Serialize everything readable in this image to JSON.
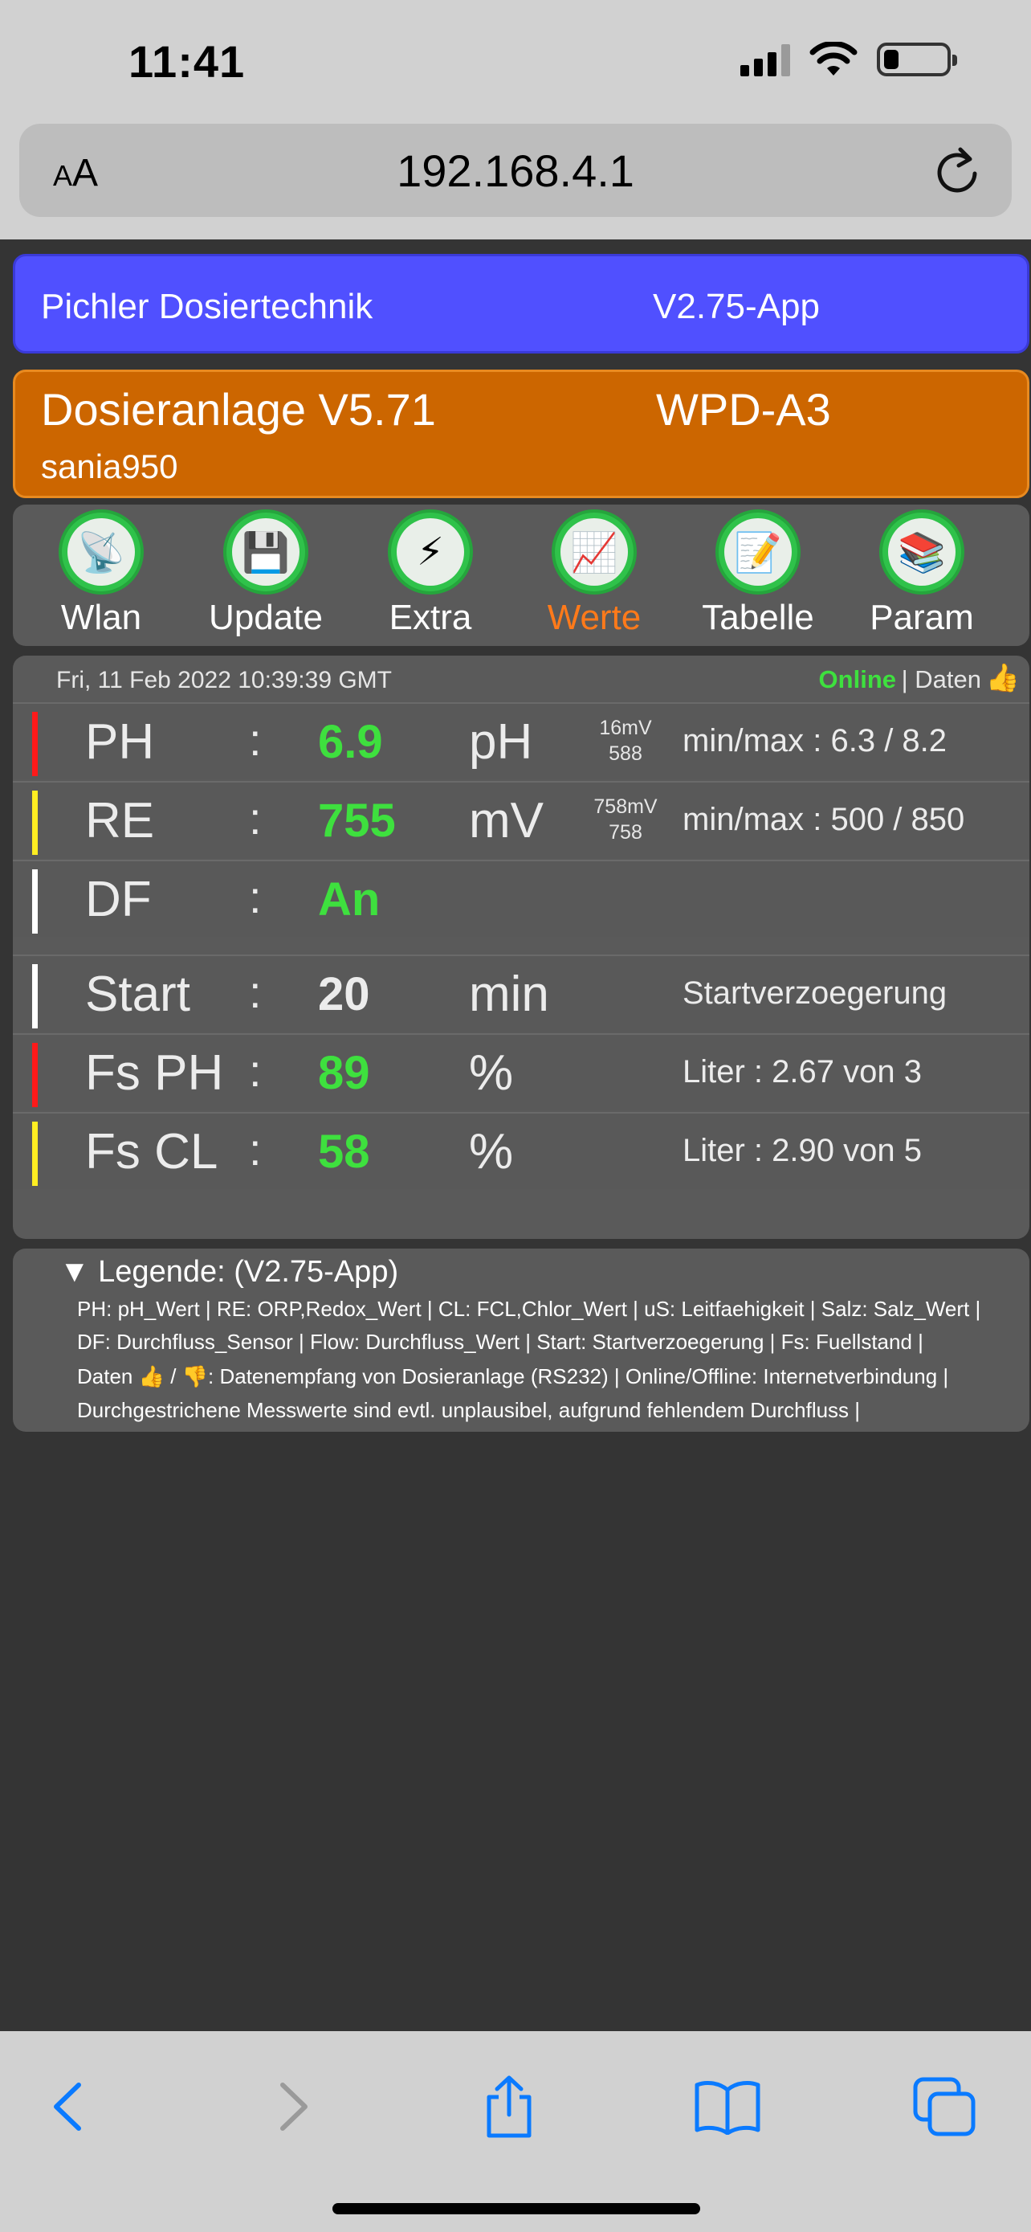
{
  "status": {
    "time": "11:41"
  },
  "browser": {
    "text_size_small": "A",
    "text_size_large": "A",
    "url": "192.168.4.1"
  },
  "header": {
    "company": "Pichler Dosiertechnik",
    "app_version": "V2.75-App"
  },
  "device": {
    "title": "Dosieranlage V5.71",
    "model": "WPD-A3",
    "user": "sania950"
  },
  "nav": [
    {
      "label": "Wlan",
      "icon": "satellite-dish-icon",
      "glyph": "📡",
      "active": false
    },
    {
      "label": "Update",
      "icon": "floppy-disk-icon",
      "glyph": "💾",
      "active": false
    },
    {
      "label": "Extra",
      "icon": "lightning-icon",
      "glyph": "⚡",
      "active": false
    },
    {
      "label": "Werte",
      "icon": "chart-icon",
      "glyph": "📈",
      "active": true
    },
    {
      "label": "Tabelle",
      "icon": "memo-icon",
      "glyph": "📝",
      "active": false
    },
    {
      "label": "Param",
      "icon": "books-icon",
      "glyph": "📚",
      "active": false
    }
  ],
  "info": {
    "datetime": "Fri, 11 Feb 2022 10:39:39 GMT",
    "online": "Online",
    "separator": "| Daten",
    "thumb": "👍"
  },
  "measurements": [
    {
      "label": "PH",
      "colon": ":",
      "value": "6.9",
      "unit": "pH",
      "mv1": "16mV",
      "mv2": "588",
      "extra": "min/max : 6.3 / 8.2",
      "bar_color": "#ff1a1a",
      "value_color": "green"
    },
    {
      "label": "RE",
      "colon": ":",
      "value": "755",
      "unit": "mV",
      "mv1": "758mV",
      "mv2": "758",
      "extra": "min/max : 500 / 850",
      "bar_color": "#ffee22",
      "value_color": "green"
    },
    {
      "label": "DF",
      "colon": ":",
      "value": "An",
      "unit": "",
      "mv1": "",
      "mv2": "",
      "extra": "",
      "bar_color": "#ffffff",
      "value_color": "green"
    }
  ],
  "status_rows": [
    {
      "label": "Start",
      "colon": ":",
      "value": "20",
      "unit": "min",
      "extra": "Startverzoegerung",
      "bar_color": "#ffffff",
      "value_color": "white"
    },
    {
      "label": "Fs PH",
      "colon": ":",
      "value": "89",
      "unit": "%",
      "extra": "Liter : 2.67 von 3",
      "bar_color": "#ff1a1a",
      "value_color": "green"
    },
    {
      "label": "Fs CL",
      "colon": ":",
      "value": "58",
      "unit": "%",
      "extra": "Liter : 2.90 von 5",
      "bar_color": "#ffee22",
      "value_color": "green"
    }
  ],
  "legend": {
    "title": "▼ Legende: (V2.75-App)",
    "lines": [
      "PH: pH_Wert | RE: ORP,Redox_Wert | CL: FCL,Chlor_Wert | uS: Leitfaehigkeit | Salz: Salz_Wert |",
      "DF: Durchfluss_Sensor | Flow: Durchfluss_Wert | Start: Startverzoegerung | Fs: Fuellstand |",
      "Daten 👍 / 👎:  Datenempfang von Dosieranlage (RS232) | Online/Offline: Internetverbindung |",
      "Durchgestrichene Messwerte sind evtl. unplausibel, aufgrund fehlendem Durchfluss |"
    ]
  },
  "colors": {
    "accent_blue": "#0a7aff",
    "green_value": "#3ee03e",
    "orange_active": "#ff7a1a"
  }
}
